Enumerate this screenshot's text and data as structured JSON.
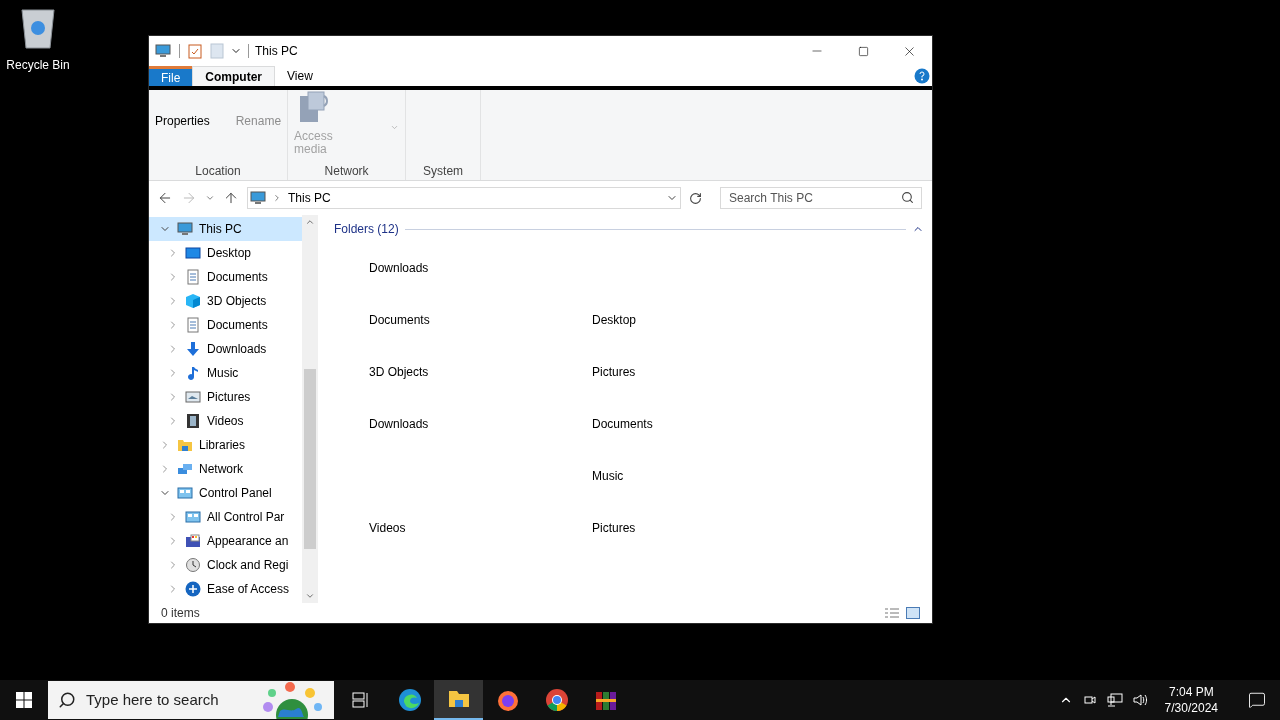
{
  "desktop": {
    "icons": [
      {
        "label": "Recycle Bin"
      }
    ]
  },
  "window": {
    "title": "This PC",
    "ribbon": {
      "tabs": [
        {
          "label": "File",
          "kind": "file",
          "selected": false
        },
        {
          "label": "Computer",
          "kind": "tab",
          "selected": true
        },
        {
          "label": "View",
          "kind": "tab",
          "selected": false
        }
      ],
      "groups": [
        {
          "label": "Location",
          "commands": [
            {
              "label": "Properties",
              "disabled": false
            },
            {
              "label": "Rename",
              "disabled": true
            }
          ]
        },
        {
          "label": "Network",
          "commands": [
            {
              "label": "Access media",
              "kind": "large",
              "disabled": true
            }
          ]
        },
        {
          "label": "System"
        }
      ]
    },
    "address": {
      "path": "This PC"
    },
    "search": {
      "placeholder": "Search This PC"
    },
    "tree": [
      {
        "label": "This PC",
        "kind": "pc",
        "expanded": true,
        "selected": true,
        "children": [
          {
            "label": "Desktop",
            "kind": "desktop",
            "expanded": false,
            "selected": false
          },
          {
            "label": "Documents",
            "kind": "doc",
            "expanded": false,
            "selected": false
          },
          {
            "label": "3D Objects",
            "kind": "cube",
            "expanded": false,
            "selected": false
          },
          {
            "label": "Documents",
            "kind": "doc",
            "expanded": false,
            "selected": false
          },
          {
            "label": "Downloads",
            "kind": "download",
            "expanded": false,
            "selected": false
          },
          {
            "label": "Music",
            "kind": "music",
            "expanded": false,
            "selected": false
          },
          {
            "label": "Pictures",
            "kind": "pictures",
            "expanded": false,
            "selected": false
          },
          {
            "label": "Videos",
            "kind": "videos",
            "expanded": false,
            "selected": false
          }
        ]
      },
      {
        "label": "Libraries",
        "kind": "libraries",
        "expanded": false,
        "selected": false
      },
      {
        "label": "Network",
        "kind": "network",
        "expanded": false,
        "selected": false
      },
      {
        "label": "Control Panel",
        "kind": "cpanel",
        "expanded": true,
        "selected": false,
        "children": [
          {
            "label": "All Control Par",
            "kind": "cpanel",
            "expanded": false,
            "selected": false
          },
          {
            "label": "Appearance an",
            "kind": "appearance",
            "expanded": false,
            "selected": false
          },
          {
            "label": "Clock and Regi",
            "kind": "clock",
            "expanded": false,
            "selected": false
          },
          {
            "label": "Ease of Access",
            "kind": "ease",
            "expanded": false,
            "selected": false
          }
        ]
      }
    ],
    "section": {
      "title": "Folders (12)",
      "expanded": true
    },
    "folder_rows": [
      {
        "column_1": "Downloads"
      },
      {
        "column_1": "Documents",
        "column_2": "Desktop"
      },
      {
        "column_1": "3D Objects",
        "column_2": "Pictures"
      },
      {
        "column_1": "Downloads",
        "column_2": "Documents"
      },
      {
        "column_2": "Music"
      },
      {
        "column_1": "Videos",
        "column_2": "Pictures"
      }
    ],
    "status_bar": {
      "count": "0 items"
    }
  },
  "taskbar": {
    "search": {
      "placeholder": "Type here to search"
    },
    "apps": [
      {
        "kind": "taskview",
        "selected": false
      },
      {
        "kind": "edge",
        "selected": false
      },
      {
        "kind": "explorer",
        "selected": true
      },
      {
        "kind": "firefox",
        "selected": false
      },
      {
        "kind": "chrome",
        "selected": false
      },
      {
        "kind": "winrar",
        "selected": false
      }
    ],
    "clock": {
      "time": "7:04 PM",
      "date": "7/30/2024"
    }
  }
}
